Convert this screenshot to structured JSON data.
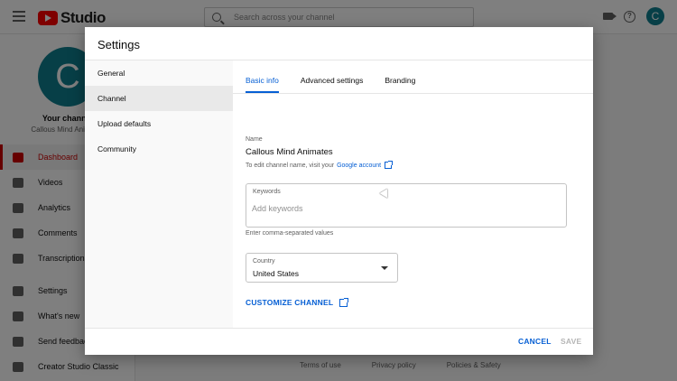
{
  "app": {
    "logo_text": "Studio",
    "search_placeholder": "Search across your channel",
    "avatar_letter": "C"
  },
  "sidebar": {
    "avatar_letter": "C",
    "channel_label": "Your channel",
    "channel_name": "Callous Mind Animates",
    "items": [
      {
        "label": "Dashboard",
        "active": true
      },
      {
        "label": "Videos"
      },
      {
        "label": "Analytics"
      },
      {
        "label": "Comments"
      },
      {
        "label": "Transcriptions"
      },
      {
        "label": "Settings"
      },
      {
        "label": "What's new"
      },
      {
        "label": "Send feedback"
      },
      {
        "label": "Creator Studio Classic"
      }
    ]
  },
  "footer": {
    "links": [
      "Terms of use",
      "Privacy policy",
      "Policies & Safety"
    ]
  },
  "dialog": {
    "title": "Settings",
    "side_items": [
      {
        "label": "General"
      },
      {
        "label": "Channel",
        "active": true
      },
      {
        "label": "Upload defaults"
      },
      {
        "label": "Community"
      }
    ],
    "tabs": [
      {
        "label": "Basic info",
        "active": true
      },
      {
        "label": "Advanced settings"
      },
      {
        "label": "Branding"
      }
    ],
    "name_label": "Name",
    "name_value": "Callous Mind Animates",
    "edit_hint": "To edit channel name, visit your",
    "edit_hint_link": "Google account",
    "keywords_label": "Keywords",
    "keywords_placeholder": "Add keywords",
    "keywords_helper": "Enter comma-separated values",
    "country_label": "Country",
    "country_value": "United States",
    "customize_label": "CUSTOMIZE CHANNEL",
    "cancel_label": "CANCEL",
    "save_label": "SAVE"
  },
  "colors": {
    "accent": "#065fd4",
    "brand_red": "#ff0000",
    "avatar": "#0e7f8e"
  }
}
